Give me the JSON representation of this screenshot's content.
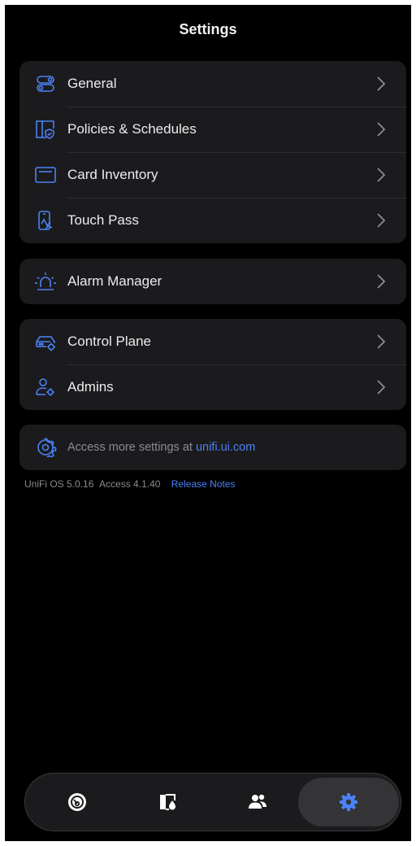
{
  "header": {
    "title": "Settings"
  },
  "groups": {
    "main": [
      {
        "label": "General",
        "icon": "toggles-icon"
      },
      {
        "label": "Policies & Schedules",
        "icon": "door-shield-icon"
      },
      {
        "label": "Card Inventory",
        "icon": "card-icon"
      },
      {
        "label": "Touch Pass",
        "icon": "phone-tap-icon"
      }
    ],
    "alarm": [
      {
        "label": "Alarm Manager",
        "icon": "alarm-light-icon"
      }
    ],
    "system": [
      {
        "label": "Control Plane",
        "icon": "router-gear-icon"
      },
      {
        "label": "Admins",
        "icon": "user-gear-icon"
      }
    ]
  },
  "more_settings": {
    "prefix": "Access more settings at ",
    "link": "unifi.ui.com",
    "icon": "gear-outline-icon"
  },
  "version_info": {
    "os": "UniFi OS 5.0.16",
    "access": "Access 4.1.40",
    "release_notes": "Release Notes"
  },
  "tabbar": {
    "tabs": [
      {
        "name": "dashboard",
        "icon": "gauge-icon"
      },
      {
        "name": "doors",
        "icon": "door-icon"
      },
      {
        "name": "users",
        "icon": "users-icon"
      },
      {
        "name": "settings",
        "icon": "gear-icon",
        "active": true
      }
    ]
  },
  "colors": {
    "accent": "#4b82f6",
    "background": "#000000",
    "card": "#1b1b1d"
  }
}
